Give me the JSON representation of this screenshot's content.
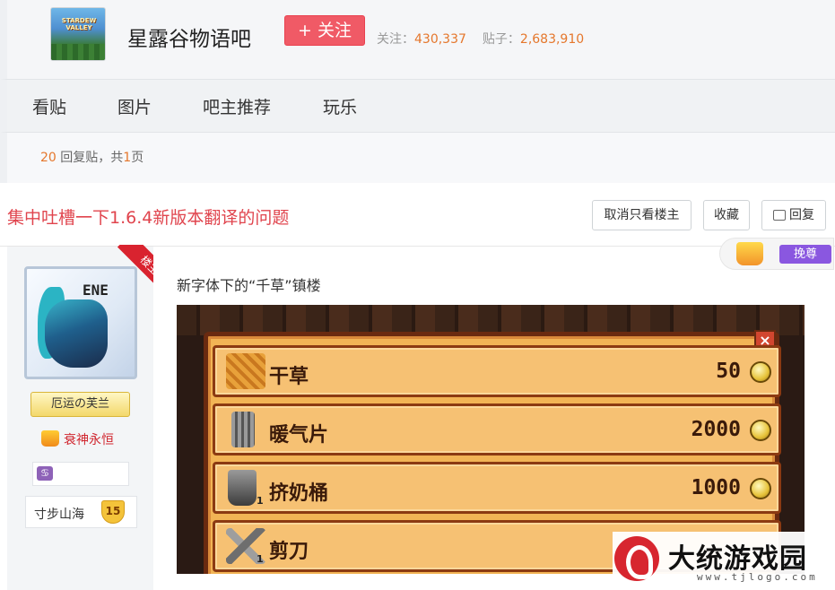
{
  "forum": {
    "logo_text": "STARDEW VALLEY",
    "name": "星露谷物语吧",
    "follow_label": "+ 关注",
    "followers_label": "关注：",
    "followers": "430,337",
    "posts_label": "贴子：",
    "posts": "2,683,910"
  },
  "nav": {
    "tabs": [
      "看贴",
      "图片",
      "吧主推荐",
      "玩乐"
    ]
  },
  "reply_bar": {
    "count": "20",
    "text": " 回复贴，共",
    "pages": "1",
    "suffix": "页"
  },
  "thread": {
    "title": "集中吐槽一下1.6.4新版本翻译的问题",
    "buttons": {
      "only_op": "取消只看楼主",
      "favorite": "收藏",
      "reply": "回复"
    }
  },
  "author": {
    "ribbon": "楼主",
    "avatar_text": "ENE",
    "rank_title": "厄运の芙兰",
    "medal": "衰神永恒",
    "sign_icon": "♋",
    "level_name": "寸步山海",
    "level": "15"
  },
  "post": {
    "vip_badge": "挽尊",
    "text": "新字体下的“千草”镇楼",
    "shop_items": [
      {
        "name": "干草",
        "price": "50",
        "qty": "",
        "icon": "hay-icon",
        "color": "#e8a13a"
      },
      {
        "name": "暖气片",
        "price": "2000",
        "qty": "",
        "icon": "heater-icon",
        "color": "#7a7a7a"
      },
      {
        "name": "挤奶桶",
        "price": "1000",
        "qty": "1",
        "icon": "milk-pail-icon",
        "color": "#5e5e5e"
      },
      {
        "name": "剪刀",
        "price": "",
        "qty": "1",
        "icon": "shears-icon",
        "color": "#8a8a8a"
      }
    ]
  },
  "watermark": {
    "brand": "大统游戏园",
    "url": "www.tjlogo.com"
  }
}
